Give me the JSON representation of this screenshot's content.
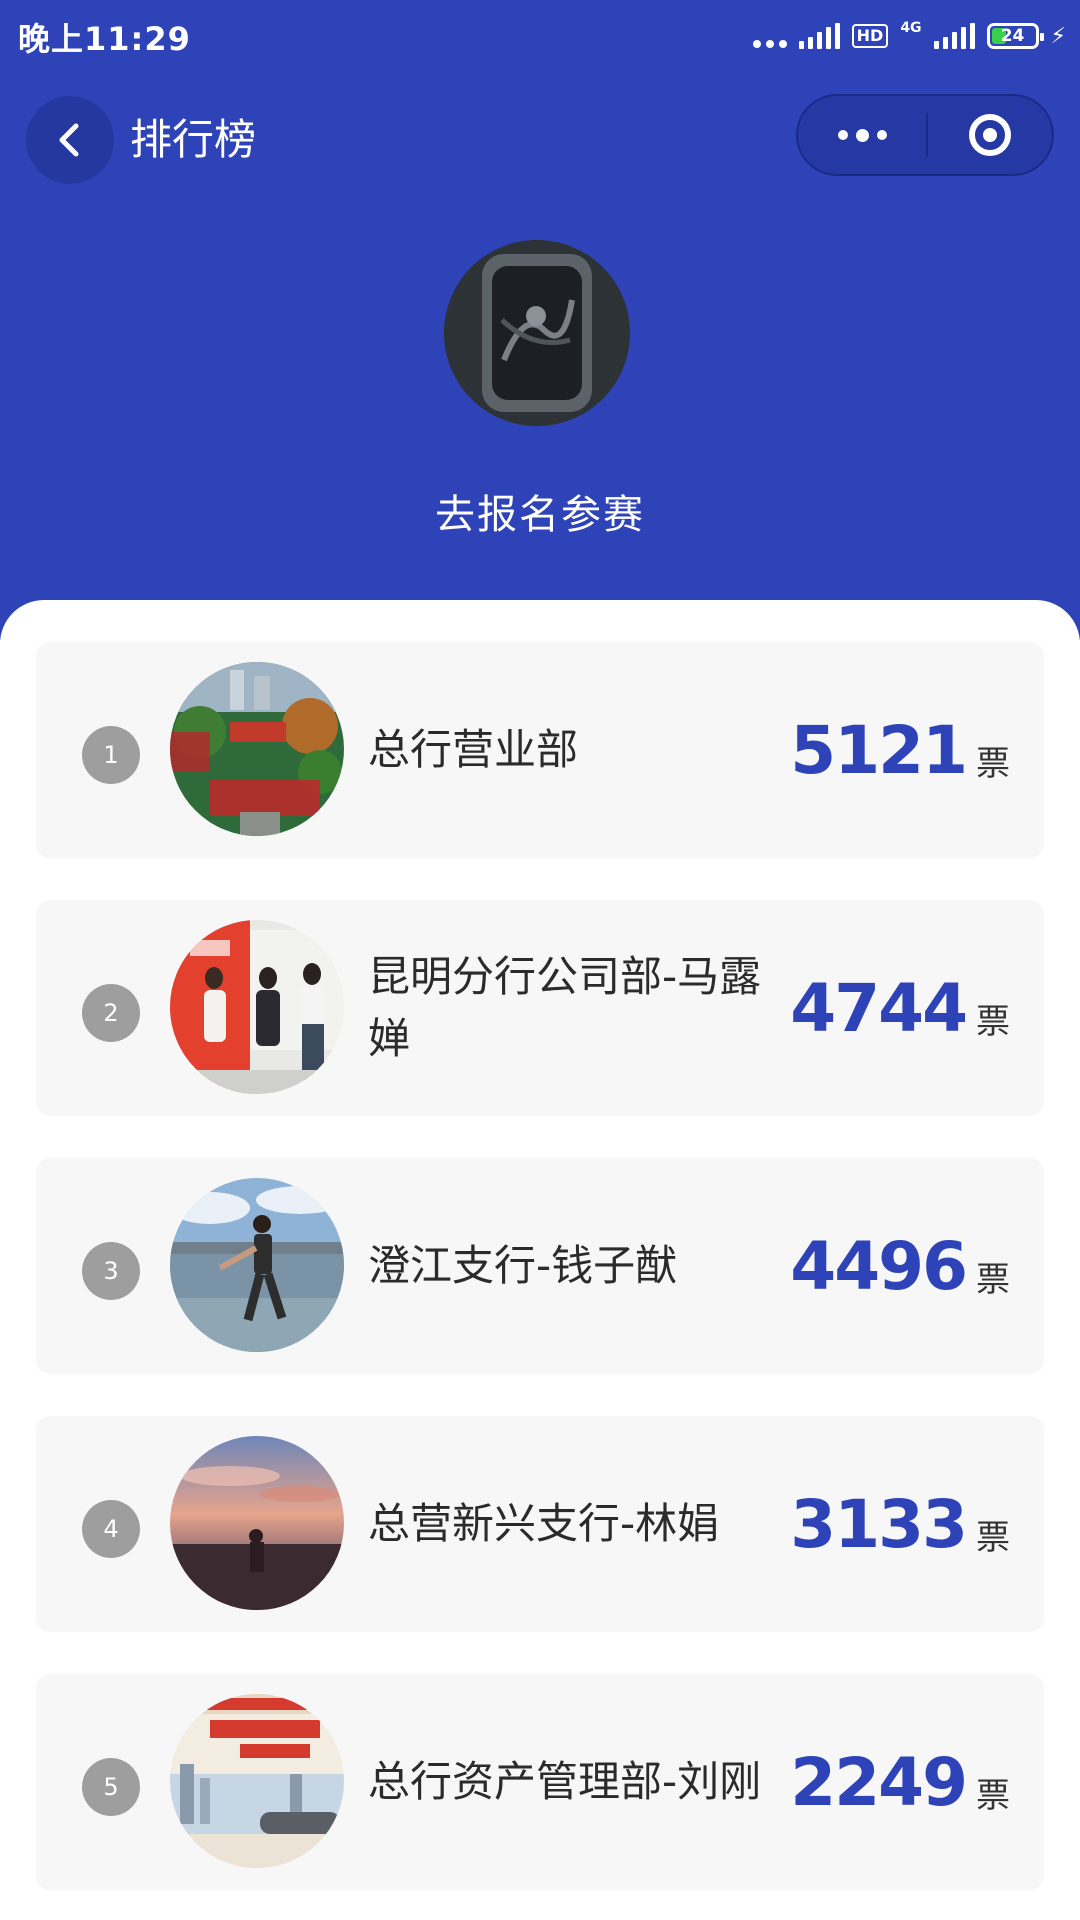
{
  "status_bar": {
    "time": "晚上11:29",
    "hd": "HD",
    "network": "4G",
    "battery": "24"
  },
  "nav": {
    "title": "排行榜"
  },
  "signup": {
    "label": "去报名参赛"
  },
  "vote_unit": "票",
  "ranking": [
    {
      "rank": "1",
      "name": "总行营业部",
      "votes": "5121"
    },
    {
      "rank": "2",
      "name": "昆明分行公司部-马露婵",
      "votes": "4744"
    },
    {
      "rank": "3",
      "name": "澄江支行-钱子猷",
      "votes": "4496"
    },
    {
      "rank": "4",
      "name": "总营新兴支行-林娟",
      "votes": "3133"
    },
    {
      "rank": "5",
      "name": "总行资产管理部-刘刚",
      "votes": "2249"
    }
  ],
  "colors": {
    "header_bg": "#2f43b8",
    "vote_color": "#2f43b8",
    "card_bg": "#f7f7f7"
  }
}
